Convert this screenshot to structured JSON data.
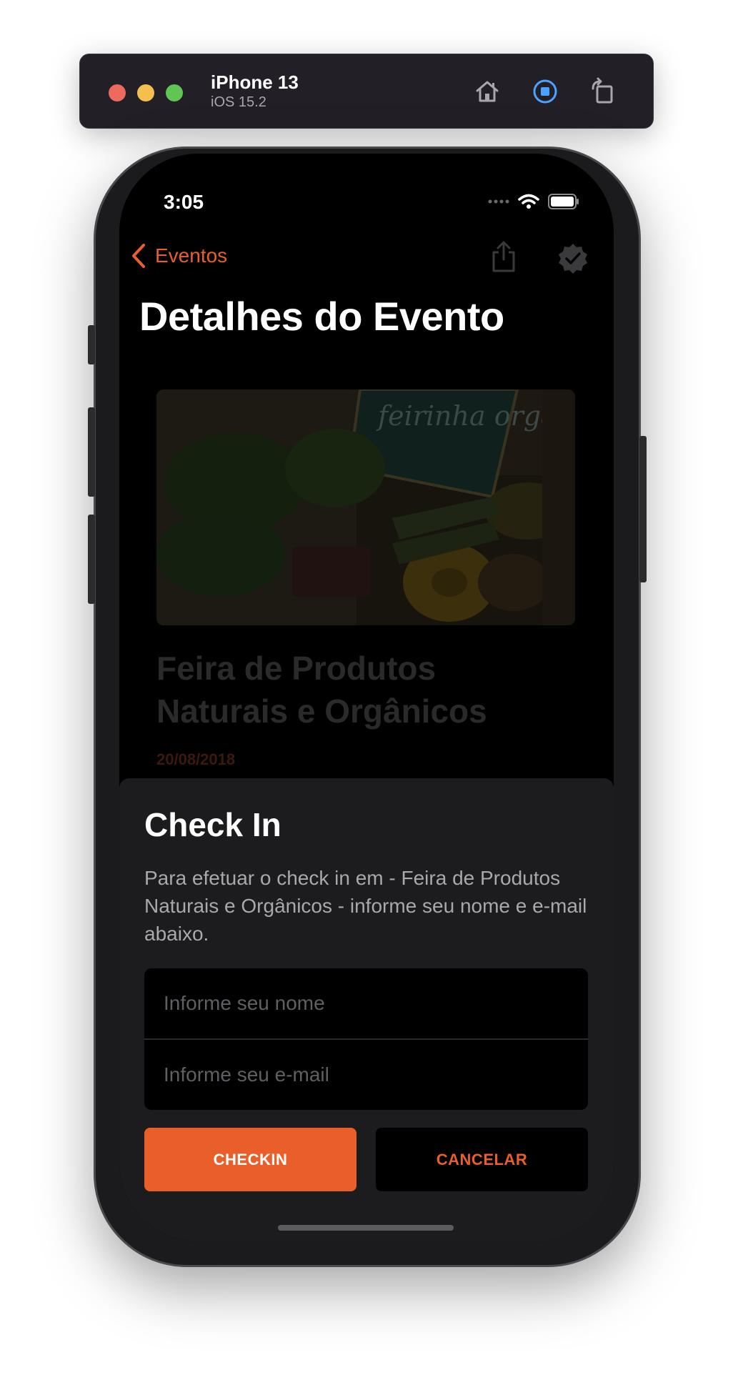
{
  "simulator": {
    "device": "iPhone 13",
    "os": "iOS 15.2",
    "toolbar_icons": [
      "home-icon",
      "record-icon",
      "rotate-icon"
    ]
  },
  "status_bar": {
    "time": "3:05",
    "icons": [
      "signal-dots-icon",
      "wifi-icon",
      "battery-icon"
    ]
  },
  "nav": {
    "back_label": "Eventos",
    "accent_color": "#ea5e2a",
    "right_icons": [
      "share-icon",
      "verified-badge-icon"
    ]
  },
  "page": {
    "title": "Detalhes do Evento"
  },
  "event": {
    "image_text": "feirinha orgânica",
    "title": "Feira de Produtos Naturais e Orgânicos",
    "date": "20/08/2018"
  },
  "checkin_sheet": {
    "title": "Check In",
    "description": "Para efetuar o check in em - Feira de Produtos Naturais e Orgânicos - informe seu nome e e-mail abaixo.",
    "name_placeholder": "Informe seu nome",
    "email_placeholder": "Informe seu e-mail",
    "checkin_label": "CHECKIN",
    "cancel_label": "CANCELAR"
  }
}
